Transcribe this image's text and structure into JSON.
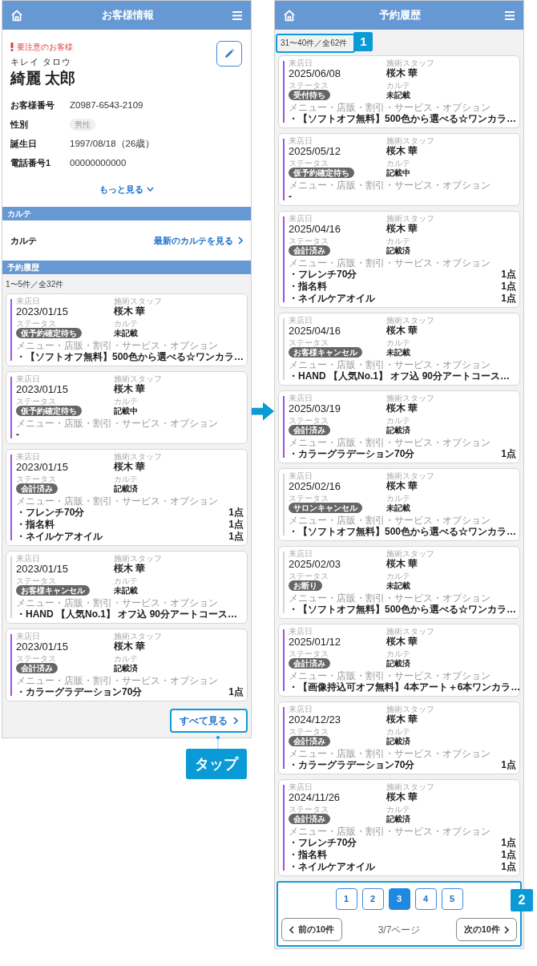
{
  "left_screen": {
    "title": "お客様情報",
    "alert": "要注意のお客様",
    "kana": "キレイ タロウ",
    "name": "綺麗 太郎",
    "fields": [
      {
        "label": "お客様番号",
        "value": "Z0987-6543-2109",
        "kind": "text"
      },
      {
        "label": "性別",
        "value": "男性",
        "kind": "tag"
      },
      {
        "label": "誕生日",
        "value": "1997/08/18（26歳）",
        "kind": "text"
      },
      {
        "label": "電話番号1",
        "value": "00000000000",
        "kind": "text"
      }
    ],
    "more": "もっと見る",
    "karte_section": "カルテ",
    "karte_label": "カルテ",
    "karte_link": "最新のカルテを見る",
    "history_section": "予約履歴",
    "count": "1〜5件／全32件",
    "cards": [
      {
        "visit_label": "来店日",
        "date": "2023/01/15",
        "staff_label": "施術スタッフ",
        "staff": "桜木 華",
        "status_label": "ステータス",
        "status": "仮予約確定待ち",
        "karte_label": "カルテ",
        "karte": "未記載",
        "menu_label": "メニュー・店販・割引・サービス・オプション",
        "color": "#a24ff0",
        "items": [
          {
            "name": "・【ソフトオフ無料】500色から選べる☆ワンカラ…"
          }
        ]
      },
      {
        "visit_label": "来店日",
        "date": "2023/01/15",
        "staff_label": "施術スタッフ",
        "staff": "桜木 華",
        "status_label": "ステータス",
        "status": "仮予約確定待ち",
        "karte_label": "カルテ",
        "karte": "記載中",
        "menu_label": "メニュー・店販・割引・サービス・オプション",
        "color": "#a24ff0",
        "items": [
          {
            "name": "-"
          }
        ]
      },
      {
        "visit_label": "来店日",
        "date": "2023/01/15",
        "staff_label": "施術スタッフ",
        "staff": "桜木 華",
        "status_label": "ステータス",
        "status": "会計済み",
        "karte_label": "カルテ",
        "karte": "記載済",
        "menu_label": "メニュー・店販・割引・サービス・オプション",
        "color": "#a24ff0",
        "items": [
          {
            "name": "・フレンチ70分",
            "qty": "1点"
          },
          {
            "name": "・指名料",
            "qty": "1点"
          },
          {
            "name": "・ネイルケアオイル",
            "qty": "1点"
          }
        ]
      },
      {
        "visit_label": "来店日",
        "date": "2023/01/15",
        "staff_label": "施術スタッフ",
        "staff": "桜木 華",
        "status_label": "ステータス",
        "status": "お客様キャンセル",
        "karte_label": "カルテ",
        "karte": "未記載",
        "menu_label": "メニュー・店販・割引・サービス・オプション",
        "color": "#d4d4d4",
        "items": [
          {
            "name": "・HAND 【人気No.1】 オフ込 90分アートコース…"
          }
        ]
      },
      {
        "visit_label": "来店日",
        "date": "2023/01/15",
        "staff_label": "施術スタッフ",
        "staff": "桜木 華",
        "status_label": "ステータス",
        "status": "会計済み",
        "karte_label": "カルテ",
        "karte": "記載済",
        "menu_label": "メニュー・店販・割引・サービス・オプション",
        "color": "#a24ff0",
        "items": [
          {
            "name": "・カラーグラデーション70分",
            "qty": "1点"
          }
        ]
      }
    ],
    "see_all": "すべて見る"
  },
  "tap_callout": "タップ",
  "right_screen": {
    "title": "予約履歴",
    "count": "31〜40件／全62件",
    "count_callout": "1",
    "cards": [
      {
        "visit_label": "来店日",
        "date": "2025/06/08",
        "staff_label": "施術スタッフ",
        "staff": "桜木 華",
        "status_label": "ステータス",
        "status": "受付待ち",
        "karte_label": "カルテ",
        "karte": "未記載",
        "menu_label": "メニュー・店販・割引・サービス・オプション",
        "color": "#a24ff0",
        "items": [
          {
            "name": "・【ソフトオフ無料】500色から選べる☆ワンカラ…"
          }
        ]
      },
      {
        "visit_label": "来店日",
        "date": "2025/05/12",
        "staff_label": "施術スタッフ",
        "staff": "桜木 華",
        "status_label": "ステータス",
        "status": "仮予約確定待ち",
        "karte_label": "カルテ",
        "karte": "記載中",
        "menu_label": "メニュー・店販・割引・サービス・オプション",
        "color": "#a24ff0",
        "items": [
          {
            "name": "-"
          }
        ]
      },
      {
        "visit_label": "来店日",
        "date": "2025/04/16",
        "staff_label": "施術スタッフ",
        "staff": "桜木 華",
        "status_label": "ステータス",
        "status": "会計済み",
        "karte_label": "カルテ",
        "karte": "記載済",
        "menu_label": "メニュー・店販・割引・サービス・オプション",
        "color": "#a24ff0",
        "items": [
          {
            "name": "・フレンチ70分",
            "qty": "1点"
          },
          {
            "name": "・指名料",
            "qty": "1点"
          },
          {
            "name": "・ネイルケアオイル",
            "qty": "1点"
          }
        ]
      },
      {
        "visit_label": "来店日",
        "date": "2025/04/16",
        "staff_label": "施術スタッフ",
        "staff": "桜木 華",
        "status_label": "ステータス",
        "status": "お客様キャンセル",
        "karte_label": "カルテ",
        "karte": "未記載",
        "menu_label": "メニュー・店販・割引・サービス・オプション",
        "color": "#d4d4d4",
        "items": [
          {
            "name": "・HAND 【人気No.1】 オフ込 90分アートコース…"
          }
        ]
      },
      {
        "visit_label": "来店日",
        "date": "2025/03/19",
        "staff_label": "施術スタッフ",
        "staff": "桜木 華",
        "status_label": "ステータス",
        "status": "会計済み",
        "karte_label": "カルテ",
        "karte": "記載済",
        "menu_label": "メニュー・店販・割引・サービス・オプション",
        "color": "#a24ff0",
        "items": [
          {
            "name": "・カラーグラデーション70分",
            "qty": "1点"
          }
        ]
      },
      {
        "visit_label": "来店日",
        "date": "2025/02/16",
        "staff_label": "施術スタッフ",
        "staff": "桜木 華",
        "status_label": "ステータス",
        "status": "サロンキャンセル",
        "karte_label": "カルテ",
        "karte": "未記載",
        "menu_label": "メニュー・店販・割引・サービス・オプション",
        "color": "#d4d4d4",
        "items": [
          {
            "name": "・【ソフトオフ無料】500色から選べる☆ワンカラ…"
          }
        ]
      },
      {
        "visit_label": "来店日",
        "date": "2025/02/03",
        "staff_label": "施術スタッフ",
        "staff": "桜木 華",
        "status_label": "ステータス",
        "status": "お断り",
        "karte_label": "カルテ",
        "karte": "未記載",
        "menu_label": "メニュー・店販・割引・サービス・オプション",
        "color": "#d4d4d4",
        "items": [
          {
            "name": "・【ソフトオフ無料】500色から選べる☆ワンカラ…"
          }
        ]
      },
      {
        "visit_label": "来店日",
        "date": "2025/01/12",
        "staff_label": "施術スタッフ",
        "staff": "桜木 華",
        "status_label": "ステータス",
        "status": "会計済み",
        "karte_label": "カルテ",
        "karte": "記載済",
        "menu_label": "メニュー・店販・割引・サービス・オプション",
        "color": "#a24ff0",
        "items": [
          {
            "name": "・【画像持込可オフ無料】4本アート＋6本ワンカラ…"
          }
        ]
      },
      {
        "visit_label": "来店日",
        "date": "2024/12/23",
        "staff_label": "施術スタッフ",
        "staff": "桜木 華",
        "status_label": "ステータス",
        "status": "会計済み",
        "karte_label": "カルテ",
        "karte": "記載済",
        "menu_label": "メニュー・店販・割引・サービス・オプション",
        "color": "#a24ff0",
        "items": [
          {
            "name": "・カラーグラデーション70分",
            "qty": "1点"
          }
        ]
      },
      {
        "visit_label": "来店日",
        "date": "2024/11/26",
        "staff_label": "施術スタッフ",
        "staff": "桜木 華",
        "status_label": "ステータス",
        "status": "会計済み",
        "karte_label": "カルテ",
        "karte": "記載済",
        "menu_label": "メニュー・店販・割引・サービス・オプション",
        "color": "#a24ff0",
        "items": [
          {
            "name": "・フレンチ70分",
            "qty": "1点"
          },
          {
            "name": "・指名料",
            "qty": "1点"
          },
          {
            "name": "・ネイルケアオイル",
            "qty": "1点"
          }
        ]
      }
    ],
    "pages": [
      {
        "label": "1",
        "selected": false
      },
      {
        "label": "2",
        "selected": false
      },
      {
        "label": "3",
        "selected": true
      },
      {
        "label": "4",
        "selected": false
      },
      {
        "label": "5",
        "selected": false
      }
    ],
    "prev": "前の10件",
    "page_info": "3/7ページ",
    "next": "次の10件",
    "pagination_callout": "2"
  }
}
